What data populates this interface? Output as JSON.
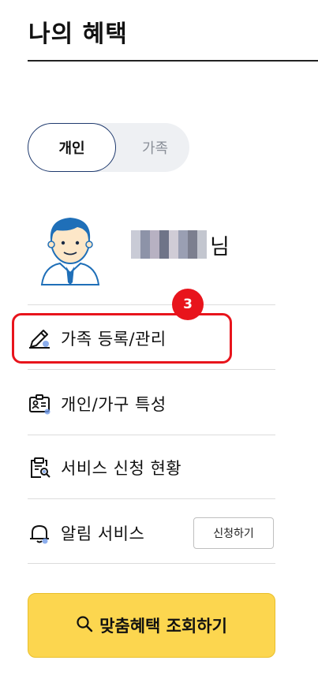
{
  "page": {
    "title": "나의 혜택"
  },
  "toggle": {
    "active": "개인",
    "inactive": "가족"
  },
  "user": {
    "name_suffix": "님",
    "mosaic_colors": [
      "#c9cbd6",
      "#8d93a8",
      "#b7b1c2",
      "#6f7488",
      "#d0ccd6",
      "#9a9fb3",
      "#7c7f8f",
      "#c3c6cf"
    ]
  },
  "step_badge": "3",
  "menu": {
    "family": "가족 등록/관리",
    "household": "개인/가구 특성",
    "service_status": "서비스 신청 현황",
    "alert": "알림 서비스",
    "alert_button": "신청하기"
  },
  "cta": {
    "label": "맞춤혜택 조회하기"
  },
  "colors": {
    "accent_red": "#e8141c",
    "brand_navy": "#1f3a6e",
    "cta_yellow": "#fcd64f",
    "icon_dot_blue": "#6f9ae8"
  }
}
